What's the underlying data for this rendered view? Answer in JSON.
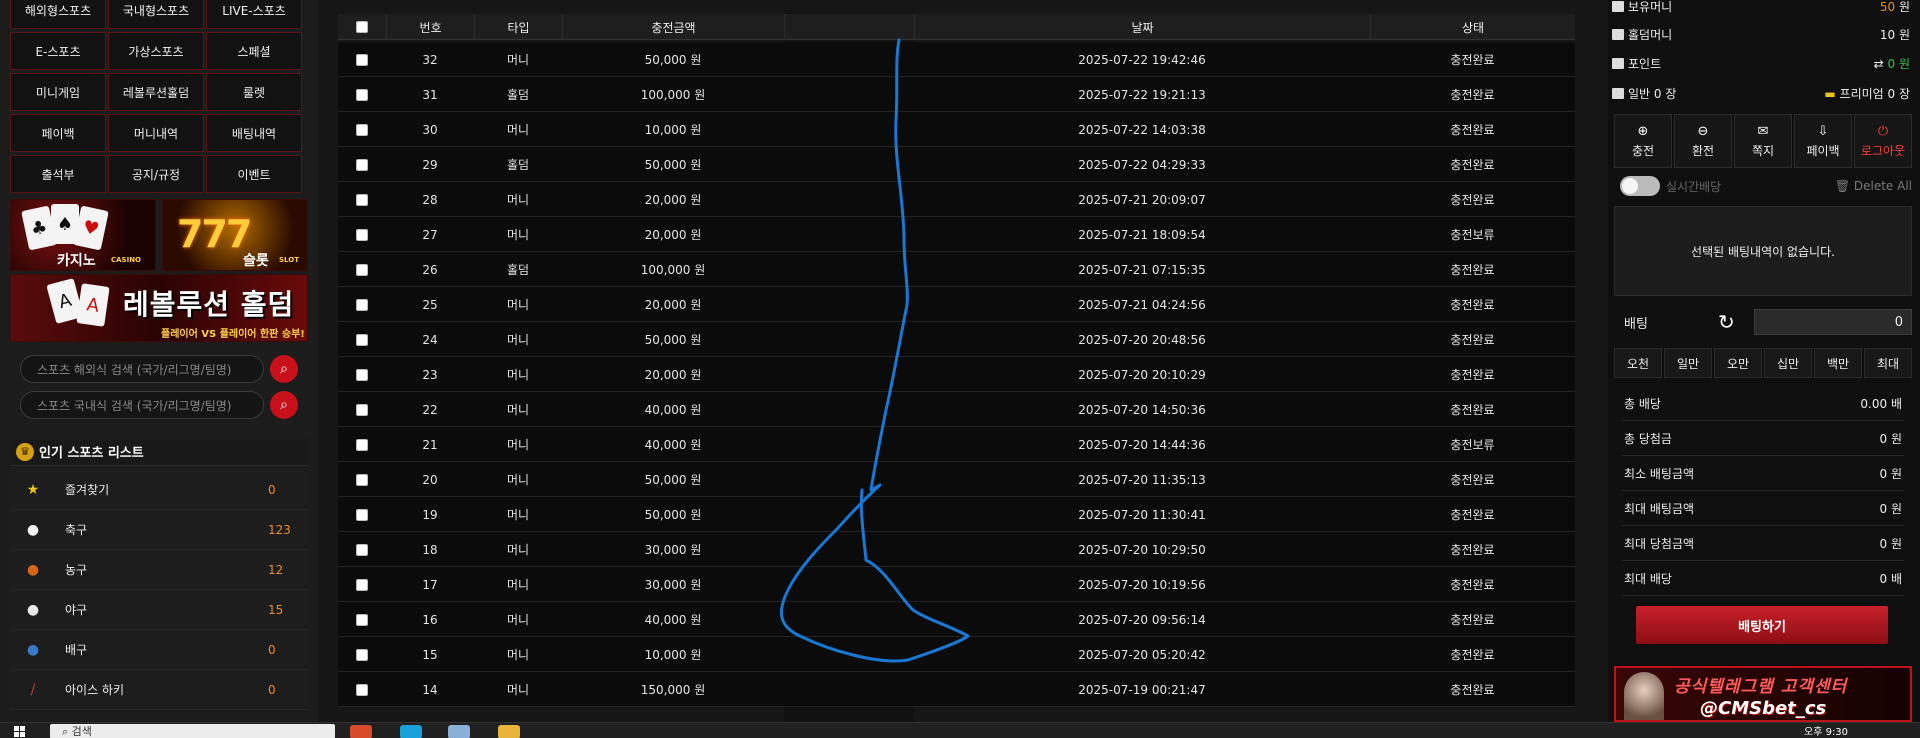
{
  "menu": [
    {
      "label": "해외형스포츠"
    },
    {
      "label": "국내형스포츠"
    },
    {
      "label": "LIVE-스포츠"
    },
    {
      "label": "E-스포츠"
    },
    {
      "label": "가상스포츠"
    },
    {
      "label": "스페셜"
    },
    {
      "label": "미니게임"
    },
    {
      "label": "레볼루션홀덤"
    },
    {
      "label": "룰렛"
    },
    {
      "label": "페이백"
    },
    {
      "label": "머니내역"
    },
    {
      "label": "배팅내역"
    },
    {
      "label": "출석부"
    },
    {
      "label": "공지/규정"
    },
    {
      "label": "이벤트"
    }
  ],
  "banners": {
    "casino": {
      "title": "카지노",
      "sub": "CASINO"
    },
    "slot": {
      "title": "슬롯",
      "sub": "SLOT",
      "sevens": "777"
    },
    "holdem": {
      "title": "레볼루션 홀덤",
      "sub": "플레이어 VS 플레이어 한판 승부!"
    }
  },
  "search": {
    "overseas_placeholder": "스포츠 해외식 검색 (국가/리그명/팀명)",
    "domestic_placeholder": "스포츠 국내식 검색 (국가/리그명/팀명)"
  },
  "sports": {
    "header": "인기 스포츠 리스트",
    "items": [
      {
        "name": "즐겨찾기",
        "count": "0",
        "icon": "star-icon",
        "glyph": "★",
        "color": "#f2c21b"
      },
      {
        "name": "축구",
        "count": "123",
        "icon": "soccer-ball-icon",
        "glyph": "●",
        "color": "#f2f2f2"
      },
      {
        "name": "농구",
        "count": "12",
        "icon": "basketball-icon",
        "glyph": "●",
        "color": "#d8641c"
      },
      {
        "name": "야구",
        "count": "15",
        "icon": "baseball-icon",
        "glyph": "●",
        "color": "#e8e8e8"
      },
      {
        "name": "배구",
        "count": "0",
        "icon": "volleyball-icon",
        "glyph": "●",
        "color": "#3a78c8"
      },
      {
        "name": "아이스 하키",
        "count": "0",
        "icon": "ice-hockey-icon",
        "glyph": "/",
        "color": "#c83a3a"
      }
    ]
  },
  "table": {
    "headers": {
      "no": "번호",
      "type": "타입",
      "amount": "충전금액",
      "date": "날짜",
      "status": "상태"
    },
    "rows": [
      {
        "no": "32",
        "type": "머니",
        "amount": "50,000 원",
        "date": "2025-07-22 19:42:46",
        "status": "충전완료"
      },
      {
        "no": "31",
        "type": "홀덤",
        "amount": "100,000 원",
        "date": "2025-07-22 19:21:13",
        "status": "충전완료"
      },
      {
        "no": "30",
        "type": "머니",
        "amount": "10,000 원",
        "date": "2025-07-22 14:03:38",
        "status": "충전완료"
      },
      {
        "no": "29",
        "type": "홀덤",
        "amount": "50,000 원",
        "date": "2025-07-22 04:29:33",
        "status": "충전완료"
      },
      {
        "no": "28",
        "type": "머니",
        "amount": "20,000 원",
        "date": "2025-07-21 20:09:07",
        "status": "충전완료"
      },
      {
        "no": "27",
        "type": "머니",
        "amount": "20,000 원",
        "date": "2025-07-21 18:09:54",
        "status": "충전보류"
      },
      {
        "no": "26",
        "type": "홀덤",
        "amount": "100,000 원",
        "date": "2025-07-21 07:15:35",
        "status": "충전완료"
      },
      {
        "no": "25",
        "type": "머니",
        "amount": "20,000 원",
        "date": "2025-07-21 04:24:56",
        "status": "충전완료"
      },
      {
        "no": "24",
        "type": "머니",
        "amount": "50,000 원",
        "date": "2025-07-20 20:48:56",
        "status": "충전완료"
      },
      {
        "no": "23",
        "type": "머니",
        "amount": "20,000 원",
        "date": "2025-07-20 20:10:29",
        "status": "충전완료"
      },
      {
        "no": "22",
        "type": "머니",
        "amount": "40,000 원",
        "date": "2025-07-20 14:50:36",
        "status": "충전완료"
      },
      {
        "no": "21",
        "type": "머니",
        "amount": "40,000 원",
        "date": "2025-07-20 14:44:36",
        "status": "충전보류"
      },
      {
        "no": "20",
        "type": "머니",
        "amount": "50,000 원",
        "date": "2025-07-20 11:35:13",
        "status": "충전완료"
      },
      {
        "no": "19",
        "type": "머니",
        "amount": "50,000 원",
        "date": "2025-07-20 11:30:41",
        "status": "충전완료"
      },
      {
        "no": "18",
        "type": "머니",
        "amount": "30,000 원",
        "date": "2025-07-20 10:29:50",
        "status": "충전완료"
      },
      {
        "no": "17",
        "type": "머니",
        "amount": "30,000 원",
        "date": "2025-07-20 10:19:56",
        "status": "충전완료"
      },
      {
        "no": "16",
        "type": "머니",
        "amount": "40,000 원",
        "date": "2025-07-20 09:56:14",
        "status": "충전완료"
      },
      {
        "no": "15",
        "type": "머니",
        "amount": "10,000 원",
        "date": "2025-07-20 05:20:42",
        "status": "충전완료"
      },
      {
        "no": "14",
        "type": "머니",
        "amount": "150,000 원",
        "date": "2025-07-19 00:21:47",
        "status": "충전완료"
      }
    ]
  },
  "account": {
    "money_label": "보유머니",
    "money_value": "50",
    "money_unit": "원",
    "holdem_label": "홀덤머니",
    "holdem_value": "10 원",
    "point_label": "포인트",
    "point_value": "0 원",
    "ticket_normal": "일반 0 장",
    "ticket_premium": "프리미엄 0 장"
  },
  "actions": [
    {
      "label": "충전",
      "icon": "deposit-icon",
      "glyph": "⊕"
    },
    {
      "label": "환전",
      "icon": "withdraw-icon",
      "glyph": "⊖"
    },
    {
      "label": "쪽지",
      "icon": "envelope-icon",
      "glyph": "✉"
    },
    {
      "label": "페이백",
      "icon": "payback-icon",
      "glyph": "⇩"
    },
    {
      "label": "로그아웃",
      "icon": "power-icon",
      "glyph": "⏻"
    }
  ],
  "betslip": {
    "realtime_label": "실시간배당",
    "delete_all": "Delete All",
    "empty_message": "선택된 배팅내역이 없습니다.",
    "bet_label": "배팅",
    "bet_value": "0",
    "amounts": [
      "오천",
      "일만",
      "오만",
      "십만",
      "백만",
      "최대"
    ],
    "summary": [
      {
        "label": "총 배당",
        "value": "0.00 배"
      },
      {
        "label": "총 당첨금",
        "value": "0 원"
      },
      {
        "label": "최소 배팅금액",
        "value": "0 원"
      },
      {
        "label": "최대 배팅금액",
        "value": "0 원"
      },
      {
        "label": "최대 당첨금액",
        "value": "0 원"
      },
      {
        "label": "최대 배당",
        "value": "0 배"
      }
    ],
    "submit": "배팅하기"
  },
  "cs_banner": {
    "title": "공식텔레그램 고객센터",
    "id": "@CMSbet_cs"
  },
  "taskbar": {
    "search_text": "검색",
    "clock": "오후 9:30"
  }
}
